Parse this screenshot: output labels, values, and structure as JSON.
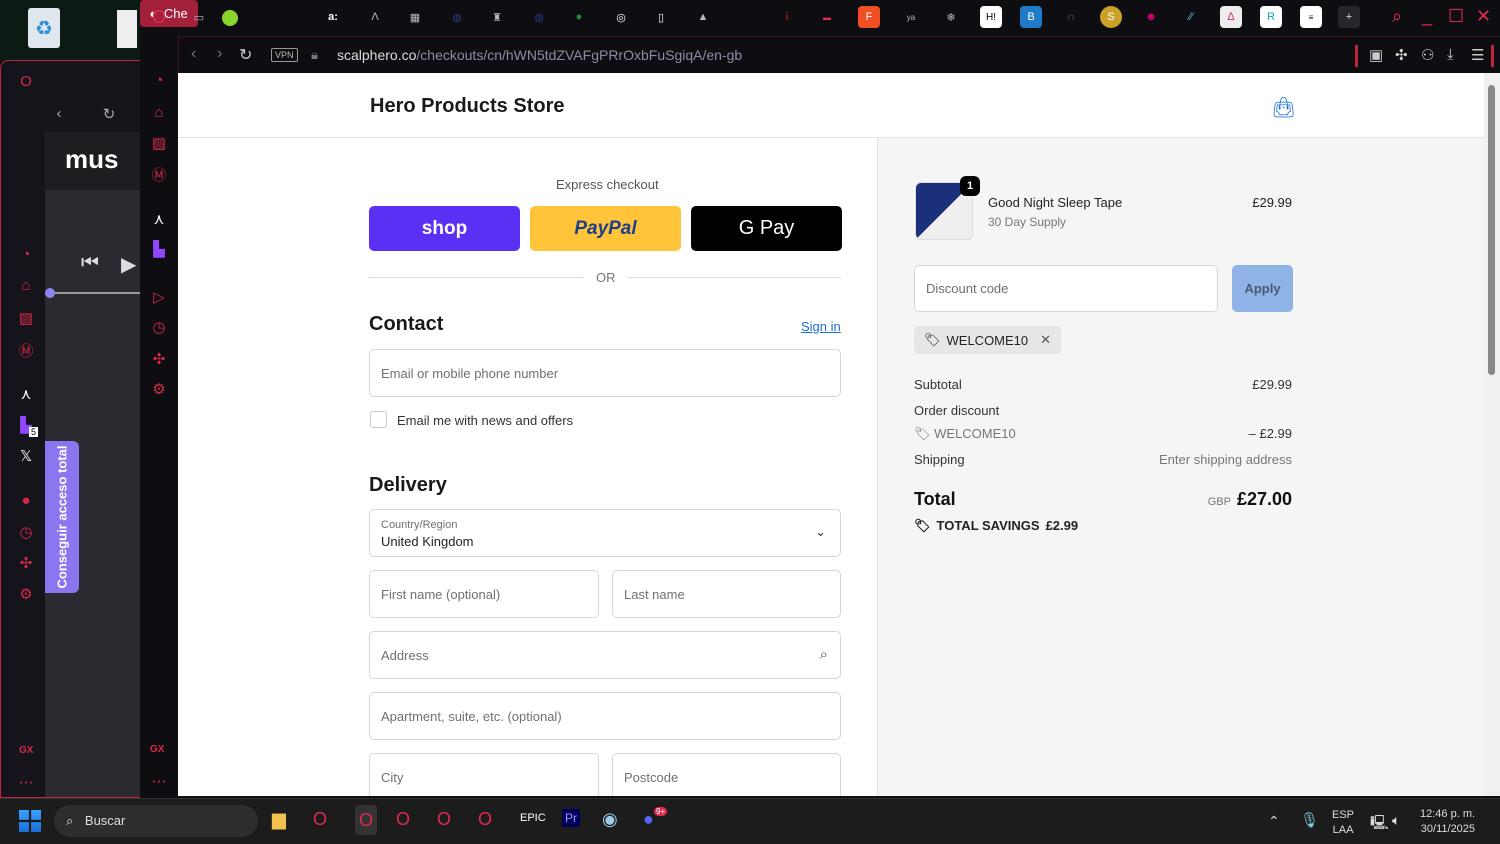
{
  "browser": {
    "active_tab_label": "Che",
    "url_domain": "scalphero.co",
    "url_path": "/checkouts/cn/hWN5tdZVAFgPRrOxbFuSgiqA/en-gb",
    "vpn_label": "VPN"
  },
  "background_window": {
    "app_title": "mus",
    "promo_label": "Conseguir acceso total",
    "twitch_badge": "5",
    "gx_label": "GX"
  },
  "store": {
    "name": "Hero Products Store"
  },
  "checkout": {
    "express_label": "Express checkout",
    "shop_label": "shop",
    "paypal_label": "PayPal",
    "gpay_label": "G Pay",
    "or_label": "OR",
    "contact_heading": "Contact",
    "sign_in": "Sign in",
    "email_placeholder": "Email or mobile phone number",
    "news_label": "Email me with news and offers",
    "delivery_heading": "Delivery",
    "country_label": "Country/Region",
    "country_value": "United Kingdom",
    "first_name": "First name (optional)",
    "last_name": "Last name",
    "address": "Address",
    "apartment": "Apartment, suite, etc. (optional)",
    "city": "City",
    "postcode": "Postcode"
  },
  "summary": {
    "item_name": "Good Night Sleep Tape",
    "item_variant": "30 Day Supply",
    "item_price": "£29.99",
    "item_qty": "1",
    "discount_placeholder": "Discount code",
    "apply_label": "Apply",
    "applied_code": "WELCOME10",
    "subtotal_label": "Subtotal",
    "subtotal_value": "£29.99",
    "order_discount_label": "Order discount",
    "discount_code": "WELCOME10",
    "discount_value": "– £2.99",
    "shipping_label": "Shipping",
    "shipping_value": "Enter shipping address",
    "total_label": "Total",
    "currency": "GBP",
    "total_value": "£27.00",
    "savings_label": "TOTAL SAVINGS",
    "savings_value": "£2.99"
  },
  "taskbar": {
    "search_label": "Buscar",
    "lang_1": "ESP",
    "lang_2": "LAA",
    "time": "12:46 p. m.",
    "date": "30/11/2025",
    "discord_badge": "9+"
  },
  "colors": {
    "accent": "#e0294f",
    "shop": "#5a31f4",
    "paypal": "#ffc439",
    "link": "#1a6ed8",
    "apply": "#8fb3e6"
  }
}
